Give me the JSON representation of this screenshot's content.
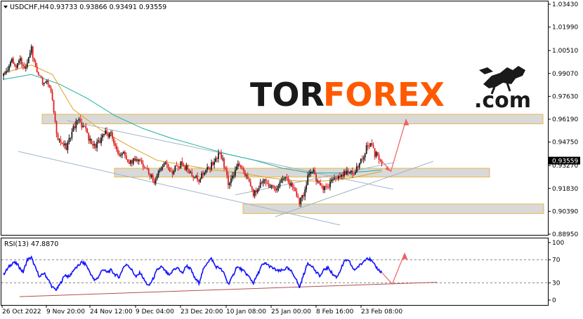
{
  "header": {
    "symbol": "USDCHF,H4",
    "ohlc": "0.93733 0.93866 0.93491 0.93559"
  },
  "rsi_panel": {
    "label": "RSI(13) 47.8870",
    "levels": [
      "100",
      "70",
      "30",
      "0"
    ]
  },
  "logo": {
    "part1": "TOR",
    "part2": "FOREX",
    "part3": ".com",
    "colors": {
      "dark": "#1a1a1a",
      "accent": "#ff5a00"
    }
  },
  "colors": {
    "bull_candle": "#1a1a1a",
    "bear_candle": "#e02020",
    "ma_fast": "#e0a020",
    "ma_slow": "#20b0a0",
    "rsi_line": "#1010ff",
    "zone_fill": "#d9d9d9",
    "zone_border": "#e8b84a",
    "channel_line": "#a0b4c8",
    "forecast_arrow": "#f06060",
    "rsi_trendline": "#b05050",
    "current_price_box": "#000000"
  },
  "chart_data": [
    {
      "type": "candlestick",
      "symbol": "USDCHF",
      "timeframe": "H4",
      "ylim": [
        0.8895,
        1.0343
      ],
      "y_ticks": [
        "1.03430",
        "1.01990",
        "1.00510",
        "0.99070",
        "0.97630",
        "0.96190",
        "0.94750",
        "0.93270",
        "0.91830",
        "0.90390",
        "0.88950"
      ],
      "x_ticks": [
        "26 Oct 2022",
        "9 Nov 20:00",
        "24 Nov 12:00",
        "9 Dec 04:00",
        "23 Dec 20:00",
        "10 Jan 08:00",
        "25 Jan 00:00",
        "8 Feb 16:00",
        "23 Feb 08:00"
      ],
      "current_price": "0.93559",
      "price_path": [
        [
          0,
          0.989
        ],
        [
          6,
          0.994
        ],
        [
          12,
          0.998
        ],
        [
          18,
          0.995
        ],
        [
          24,
          1.001
        ],
        [
          30,
          0.993
        ],
        [
          36,
          0.999
        ],
        [
          40,
          1.006
        ],
        [
          44,
          0.997
        ],
        [
          50,
          0.991
        ],
        [
          56,
          0.985
        ],
        [
          62,
          0.988
        ],
        [
          68,
          0.98
        ],
        [
          72,
          0.968
        ],
        [
          76,
          0.952
        ],
        [
          82,
          0.948
        ],
        [
          90,
          0.944
        ],
        [
          98,
          0.954
        ],
        [
          106,
          0.961
        ],
        [
          114,
          0.958
        ],
        [
          122,
          0.95
        ],
        [
          130,
          0.945
        ],
        [
          138,
          0.948
        ],
        [
          146,
          0.953
        ],
        [
          154,
          0.952
        ],
        [
          160,
          0.945
        ],
        [
          166,
          0.938
        ],
        [
          172,
          0.94
        ],
        [
          180,
          0.934
        ],
        [
          190,
          0.938
        ],
        [
          200,
          0.933
        ],
        [
          208,
          0.928
        ],
        [
          216,
          0.923
        ],
        [
          224,
          0.93
        ],
        [
          232,
          0.935
        ],
        [
          240,
          0.928
        ],
        [
          248,
          0.932
        ],
        [
          256,
          0.934
        ],
        [
          264,
          0.93
        ],
        [
          272,
          0.926
        ],
        [
          280,
          0.924
        ],
        [
          290,
          0.93
        ],
        [
          300,
          0.934
        ],
        [
          310,
          0.94
        ],
        [
          316,
          0.933
        ],
        [
          322,
          0.921
        ],
        [
          328,
          0.925
        ],
        [
          336,
          0.932
        ],
        [
          344,
          0.929
        ],
        [
          352,
          0.923
        ],
        [
          358,
          0.914
        ],
        [
          364,
          0.919
        ],
        [
          372,
          0.923
        ],
        [
          380,
          0.921
        ],
        [
          388,
          0.917
        ],
        [
          396,
          0.922
        ],
        [
          404,
          0.925
        ],
        [
          412,
          0.92
        ],
        [
          418,
          0.916
        ],
        [
          424,
          0.909
        ],
        [
          430,
          0.915
        ],
        [
          436,
          0.926
        ],
        [
          444,
          0.928
        ],
        [
          452,
          0.921
        ],
        [
          460,
          0.918
        ],
        [
          468,
          0.922
        ],
        [
          476,
          0.924
        ],
        [
          484,
          0.926
        ],
        [
          492,
          0.929
        ],
        [
          500,
          0.927
        ],
        [
          508,
          0.932
        ],
        [
          514,
          0.937
        ],
        [
          520,
          0.944
        ],
        [
          526,
          0.946
        ],
        [
          532,
          0.94
        ],
        [
          538,
          0.938
        ],
        [
          542,
          0.9356
        ]
      ],
      "ma_fast": [
        [
          0,
          0.991
        ],
        [
          40,
          0.996
        ],
        [
          70,
          0.99
        ],
        [
          100,
          0.968
        ],
        [
          140,
          0.955
        ],
        [
          180,
          0.945
        ],
        [
          220,
          0.936
        ],
        [
          260,
          0.933
        ],
        [
          300,
          0.93
        ],
        [
          340,
          0.928
        ],
        [
          380,
          0.925
        ],
        [
          420,
          0.923
        ],
        [
          460,
          0.923
        ],
        [
          500,
          0.925
        ],
        [
          542,
          0.929
        ]
      ],
      "ma_slow": [
        [
          0,
          0.987
        ],
        [
          40,
          0.99
        ],
        [
          80,
          0.984
        ],
        [
          120,
          0.975
        ],
        [
          160,
          0.964
        ],
        [
          200,
          0.956
        ],
        [
          240,
          0.95
        ],
        [
          280,
          0.945
        ],
        [
          320,
          0.94
        ],
        [
          360,
          0.936
        ],
        [
          400,
          0.931
        ],
        [
          440,
          0.928
        ],
        [
          480,
          0.928
        ],
        [
          520,
          0.929
        ],
        [
          542,
          0.93
        ]
      ],
      "zones": [
        {
          "name": "resistance",
          "y_range": [
            0.959,
            0.965
          ]
        },
        {
          "name": "middle",
          "y_range": [
            0.9255,
            0.931
          ]
        },
        {
          "name": "support",
          "y_range": [
            0.9025,
            0.9085
          ]
        }
      ],
      "forecast": [
        [
          542,
          0.9356
        ],
        [
          555,
          0.929
        ],
        [
          577,
          0.962
        ]
      ]
    },
    {
      "type": "line",
      "name": "RSI(13)",
      "current_value": 47.887,
      "ylim": [
        0,
        100
      ],
      "levels": [
        70,
        30
      ],
      "rsi_path": [
        [
          0,
          45
        ],
        [
          8,
          58
        ],
        [
          14,
          66
        ],
        [
          20,
          62
        ],
        [
          28,
          48
        ],
        [
          34,
          70
        ],
        [
          40,
          74
        ],
        [
          46,
          55
        ],
        [
          52,
          40
        ],
        [
          58,
          47
        ],
        [
          64,
          36
        ],
        [
          70,
          22
        ],
        [
          76,
          18
        ],
        [
          82,
          30
        ],
        [
          88,
          44
        ],
        [
          94,
          40
        ],
        [
          100,
          52
        ],
        [
          106,
          58
        ],
        [
          112,
          66
        ],
        [
          118,
          62
        ],
        [
          124,
          48
        ],
        [
          130,
          34
        ],
        [
          136,
          40
        ],
        [
          142,
          54
        ],
        [
          148,
          48
        ],
        [
          154,
          52
        ],
        [
          160,
          44
        ],
        [
          166,
          40
        ],
        [
          172,
          58
        ],
        [
          178,
          62
        ],
        [
          184,
          52
        ],
        [
          190,
          40
        ],
        [
          196,
          48
        ],
        [
          202,
          34
        ],
        [
          208,
          24
        ],
        [
          214,
          36
        ],
        [
          220,
          52
        ],
        [
          226,
          58
        ],
        [
          232,
          50
        ],
        [
          238,
          42
        ],
        [
          244,
          54
        ],
        [
          250,
          56
        ],
        [
          256,
          46
        ],
        [
          262,
          60
        ],
        [
          268,
          54
        ],
        [
          274,
          38
        ],
        [
          280,
          30
        ],
        [
          286,
          52
        ],
        [
          292,
          66
        ],
        [
          298,
          72
        ],
        [
          304,
          58
        ],
        [
          310,
          56
        ],
        [
          316,
          46
        ],
        [
          322,
          28
        ],
        [
          328,
          40
        ],
        [
          334,
          58
        ],
        [
          340,
          54
        ],
        [
          346,
          48
        ],
        [
          352,
          40
        ],
        [
          358,
          30
        ],
        [
          364,
          44
        ],
        [
          370,
          60
        ],
        [
          376,
          64
        ],
        [
          382,
          58
        ],
        [
          388,
          54
        ],
        [
          394,
          50
        ],
        [
          400,
          52
        ],
        [
          406,
          56
        ],
        [
          412,
          50
        ],
        [
          418,
          40
        ],
        [
          424,
          22
        ],
        [
          430,
          44
        ],
        [
          436,
          64
        ],
        [
          442,
          60
        ],
        [
          448,
          48
        ],
        [
          454,
          42
        ],
        [
          460,
          54
        ],
        [
          466,
          56
        ],
        [
          472,
          44
        ],
        [
          478,
          40
        ],
        [
          484,
          56
        ],
        [
          490,
          70
        ],
        [
          496,
          66
        ],
        [
          502,
          52
        ],
        [
          508,
          58
        ],
        [
          514,
          64
        ],
        [
          520,
          74
        ],
        [
          526,
          70
        ],
        [
          532,
          60
        ],
        [
          538,
          52
        ],
        [
          542,
          47.9
        ]
      ],
      "trendline": [
        [
          28,
          6
        ],
        [
          622,
          31
        ]
      ],
      "forecast": [
        [
          542,
          47.9
        ],
        [
          557,
          28
        ],
        [
          575,
          82
        ]
      ]
    }
  ]
}
